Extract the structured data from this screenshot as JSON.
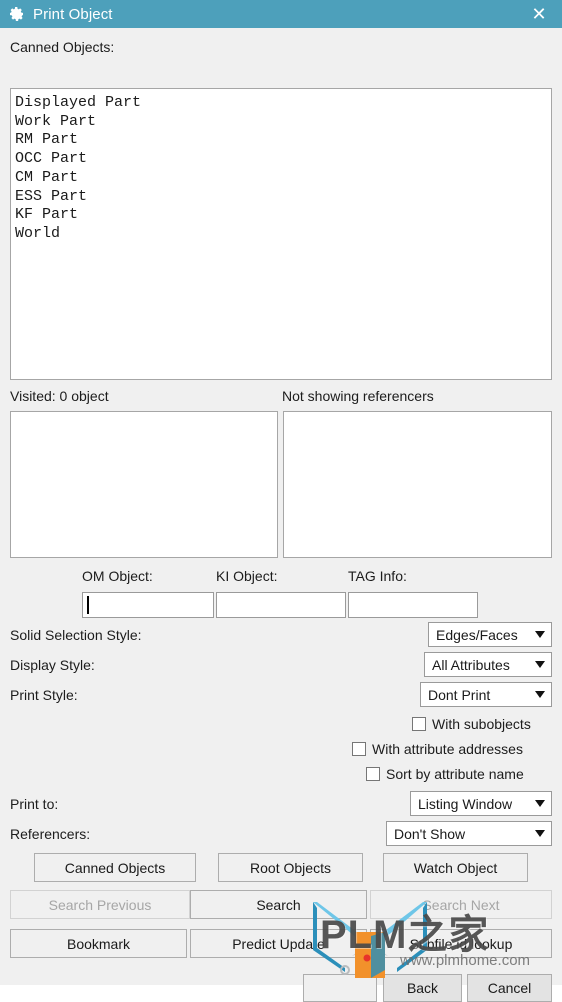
{
  "window": {
    "title": "Print Object",
    "icon": "gear-icon",
    "close_label": "✕",
    "titlebar_color": "#4da0bb",
    "body_color": "#f0f0f0"
  },
  "canned": {
    "label": "Canned Objects:",
    "items": [
      "Displayed Part",
      "Work Part",
      "RM Part",
      "OCC Part",
      "CM Part",
      "ESS Part",
      "KF Part",
      "World"
    ]
  },
  "panels": {
    "visited_label": "Visited: 0 object",
    "referencers_label": "Not showing referencers",
    "visited_items": [],
    "referencers_items": []
  },
  "fields": {
    "om": {
      "label": "OM Object:",
      "value": "",
      "placeholder": ""
    },
    "ki": {
      "label": "KI Object:",
      "value": "",
      "placeholder": ""
    },
    "tag": {
      "label": "TAG Info:",
      "value": "",
      "placeholder": ""
    }
  },
  "combos": [
    {
      "label": "Solid Selection Style:",
      "value": "Edges/Faces"
    },
    {
      "label": "Display Style:",
      "value": "All Attributes"
    },
    {
      "label": "Print Style:",
      "value": "Dont Print"
    }
  ],
  "checkboxes": [
    {
      "label": "With subobjects",
      "checked": false
    },
    {
      "label": "With attribute addresses",
      "checked": false
    },
    {
      "label": "Sort by attribute name",
      "checked": false
    }
  ],
  "combos2": [
    {
      "label": "Print to:",
      "value": "Listing Window"
    },
    {
      "label": "Referencers:",
      "value": "Don't Show"
    }
  ],
  "buttons": {
    "row1": [
      {
        "label": "Canned Objects",
        "disabled": false
      },
      {
        "label": "Root Objects",
        "disabled": false
      },
      {
        "label": "Watch Object",
        "disabled": false
      }
    ],
    "row2": [
      {
        "label": "Search Previous",
        "disabled": true
      },
      {
        "label": "Search",
        "disabled": false
      },
      {
        "label": "Search Next",
        "disabled": true
      }
    ],
    "row3": [
      {
        "label": "Bookmark",
        "disabled": false
      },
      {
        "label": "Predict Update",
        "disabled": false
      },
      {
        "label": "Subfile id lookup",
        "disabled": false
      }
    ],
    "row4": [
      {
        "label": "",
        "disabled": false
      },
      {
        "label": "Back",
        "disabled": false
      },
      {
        "label": "Cancel",
        "disabled": false
      }
    ]
  },
  "watermark": {
    "text": "PLM之家",
    "subtext": "www.plmhome.com"
  }
}
